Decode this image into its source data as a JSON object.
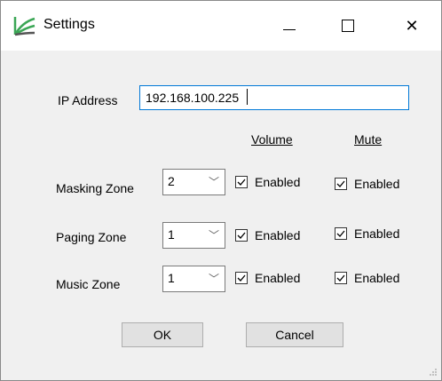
{
  "window": {
    "title": "Settings",
    "icon": "app-logo-icon"
  },
  "controls": {
    "minimize": "minimize-icon",
    "maximize": "maximize-icon",
    "close_symbol": "✕"
  },
  "ip": {
    "label": "IP Address",
    "value": "192.168.100.225"
  },
  "columns": {
    "volume": "Volume",
    "mute": "Mute"
  },
  "zones": [
    {
      "label": "Masking Zone",
      "selected": "2",
      "volume_label": "Enabled",
      "volume_checked": true,
      "mute_label": "Enabled",
      "mute_checked": true
    },
    {
      "label": "Paging Zone",
      "selected": "1",
      "volume_label": "Enabled",
      "volume_checked": true,
      "mute_label": "Enabled",
      "mute_checked": true
    },
    {
      "label": "Music Zone",
      "selected": "1",
      "volume_label": "Enabled",
      "volume_checked": true,
      "mute_label": "Enabled",
      "mute_checked": true
    }
  ],
  "buttons": {
    "ok": "OK",
    "cancel": "Cancel"
  },
  "colors": {
    "accent": "#0078d7",
    "logo_green": "#3aa655"
  }
}
